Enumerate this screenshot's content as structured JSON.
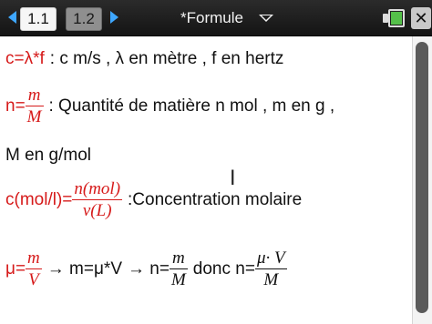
{
  "header": {
    "tabs": [
      {
        "label": "1.1",
        "active": true
      },
      {
        "label": "1.2",
        "active": false
      }
    ],
    "doc_title": "*Formule",
    "close_label": "✕"
  },
  "lines": {
    "l1": {
      "formula": "c=λ*f",
      "text": ": c m/s , λ en mètre , f en hertz"
    },
    "l2": {
      "lhs": "n=",
      "num": "m",
      "den": "M",
      "text": ": Quantité de matière n mol , m en g ,"
    },
    "l3": {
      "text": "M en g/mol"
    },
    "l4": {
      "lhs": "c(mol/l)=",
      "num": "n(mol)",
      "den": "v(L)",
      "text": ":Concentration molaire"
    },
    "l5": {
      "lhs": "μ=",
      "num1": "m",
      "den1": "V",
      "arrow1": "→ m=μ*V",
      "arrow2": "→ n=",
      "num2": "m",
      "den2": "M",
      "mid": "donc n=",
      "num3": "μ· V",
      "den3": "M"
    }
  },
  "colors": {
    "formula": "#d61a1a",
    "accent": "#3ea7ff",
    "battery": "#55c04a"
  }
}
